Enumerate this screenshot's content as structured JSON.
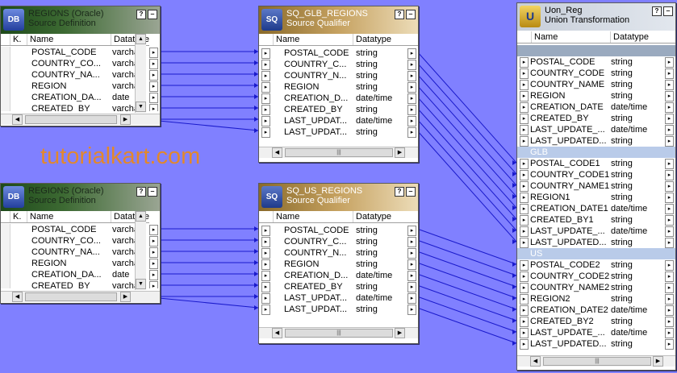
{
  "watermark": "tutorialkart.com",
  "source_definitions": [
    {
      "title_line1": "REGIONS (Oracle)",
      "title_line2": "Source Definition",
      "columns": {
        "key": "K.",
        "name": "Name",
        "datatype": "Datatype"
      },
      "rows": [
        {
          "name": "POSTAL_CODE",
          "type": "varchar"
        },
        {
          "name": "COUNTRY_CO...",
          "type": "varchar"
        },
        {
          "name": "COUNTRY_NA...",
          "type": "varchar"
        },
        {
          "name": "REGION",
          "type": "varchar"
        },
        {
          "name": "CREATION_DA...",
          "type": "date"
        },
        {
          "name": "CREATED_BY",
          "type": "varchar"
        }
      ]
    },
    {
      "title_line1": "REGIONS (Oracle)",
      "title_line2": "Source Definition",
      "columns": {
        "key": "K.",
        "name": "Name",
        "datatype": "Datatype"
      },
      "rows": [
        {
          "name": "POSTAL_CODE",
          "type": "varchar"
        },
        {
          "name": "COUNTRY_CO...",
          "type": "varchar"
        },
        {
          "name": "COUNTRY_NA...",
          "type": "varchar"
        },
        {
          "name": "REGION",
          "type": "varchar"
        },
        {
          "name": "CREATION_DA...",
          "type": "date"
        },
        {
          "name": "CREATED_BY",
          "type": "varchar"
        }
      ]
    }
  ],
  "source_qualifiers": [
    {
      "title_line1": "SQ_GLB_REGIONS",
      "title_line2": "Source Qualifier",
      "columns": {
        "name": "Name",
        "datatype": "Datatype"
      },
      "rows": [
        {
          "name": "POSTAL_CODE",
          "type": "string"
        },
        {
          "name": "COUNTRY_C...",
          "type": "string"
        },
        {
          "name": "COUNTRY_N...",
          "type": "string"
        },
        {
          "name": "REGION",
          "type": "string"
        },
        {
          "name": "CREATION_D...",
          "type": "date/time"
        },
        {
          "name": "CREATED_BY",
          "type": "string"
        },
        {
          "name": "LAST_UPDAT...",
          "type": "date/time"
        },
        {
          "name": "LAST_UPDAT...",
          "type": "string"
        }
      ]
    },
    {
      "title_line1": "SQ_US_REGIONS",
      "title_line2": "Source Qualifier",
      "columns": {
        "name": "Name",
        "datatype": "Datatype"
      },
      "rows": [
        {
          "name": "POSTAL_CODE",
          "type": "string"
        },
        {
          "name": "COUNTRY_C...",
          "type": "string"
        },
        {
          "name": "COUNTRY_N...",
          "type": "string"
        },
        {
          "name": "REGION",
          "type": "string"
        },
        {
          "name": "CREATION_D...",
          "type": "date/time"
        },
        {
          "name": "CREATED_BY",
          "type": "string"
        },
        {
          "name": "LAST_UPDAT...",
          "type": "date/time"
        },
        {
          "name": "LAST_UPDAT...",
          "type": "string"
        }
      ]
    }
  ],
  "union": {
    "title_line1": "Uon_Reg",
    "title_line2": "Union Transformation",
    "columns": {
      "name": "Name",
      "datatype": "Datatype"
    },
    "rows": [
      {
        "name": "",
        "type": "",
        "kind": "blank"
      },
      {
        "name": "POSTAL_CODE",
        "type": "string"
      },
      {
        "name": "COUNTRY_CODE",
        "type": "string"
      },
      {
        "name": "COUNTRY_NAME",
        "type": "string"
      },
      {
        "name": "REGION",
        "type": "string"
      },
      {
        "name": "CREATION_DATE",
        "type": "date/time"
      },
      {
        "name": "CREATED_BY",
        "type": "string"
      },
      {
        "name": "LAST_UPDATE_...",
        "type": "date/time"
      },
      {
        "name": "LAST_UPDATED...",
        "type": "string"
      },
      {
        "name": "GLB",
        "type": "",
        "kind": "group"
      },
      {
        "name": "POSTAL_CODE1",
        "type": "string"
      },
      {
        "name": "COUNTRY_CODE1",
        "type": "string"
      },
      {
        "name": "COUNTRY_NAME1",
        "type": "string"
      },
      {
        "name": "REGION1",
        "type": "string"
      },
      {
        "name": "CREATION_DATE1",
        "type": "date/time"
      },
      {
        "name": "CREATED_BY1",
        "type": "string"
      },
      {
        "name": "LAST_UPDATE_...",
        "type": "date/time"
      },
      {
        "name": "LAST_UPDATED...",
        "type": "string"
      },
      {
        "name": "US",
        "type": "",
        "kind": "group"
      },
      {
        "name": "POSTAL_CODE2",
        "type": "string"
      },
      {
        "name": "COUNTRY_CODE2",
        "type": "string"
      },
      {
        "name": "COUNTRY_NAME2",
        "type": "string"
      },
      {
        "name": "REGION2",
        "type": "string"
      },
      {
        "name": "CREATION_DATE2",
        "type": "date/time"
      },
      {
        "name": "CREATED_BY2",
        "type": "string"
      },
      {
        "name": "LAST_UPDATE_...",
        "type": "date/time"
      },
      {
        "name": "LAST_UPDATED...",
        "type": "string"
      }
    ]
  },
  "title_buttons": {
    "help": "?",
    "minimize": "‒"
  },
  "port_glyph": "▸",
  "scroll_glyphs": {
    "up": "▲",
    "down": "▼",
    "left": "◀",
    "right": "▶",
    "thumb": "|||"
  },
  "colors": {
    "canvas": "#8080ff",
    "link": "#1a1acc",
    "watermark": "#e2882c"
  }
}
